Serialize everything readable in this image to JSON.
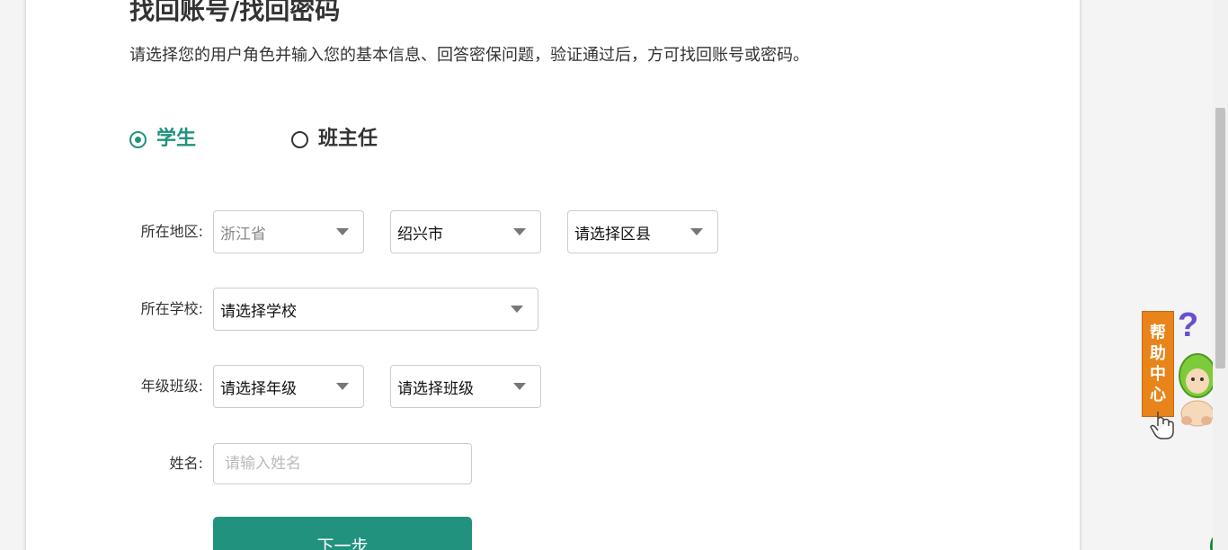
{
  "header": {
    "title": "找回账号/找回密码",
    "description": "请选择您的用户角色并输入您的基本信息、回答密保问题，验证通过后，方可找回账号或密码。"
  },
  "roles": [
    {
      "label": "学生",
      "selected": true
    },
    {
      "label": "班主任",
      "selected": false
    }
  ],
  "form": {
    "region_label": "所在地区:",
    "province": "浙江省",
    "city": "绍兴市",
    "county": "请选择区县",
    "school_label": "所在学校:",
    "school": "请选择学校",
    "class_label": "年级班级:",
    "grade": "请选择年级",
    "class": "请选择班级",
    "name_label": "姓名:",
    "name_placeholder": "请输入姓名",
    "name_value": ""
  },
  "actions": {
    "next_label": "下一步"
  },
  "help": {
    "chars": [
      "帮",
      "助",
      "中",
      "心"
    ]
  },
  "colors": {
    "accent": "#21927e",
    "help_tag": "#e8841a"
  }
}
